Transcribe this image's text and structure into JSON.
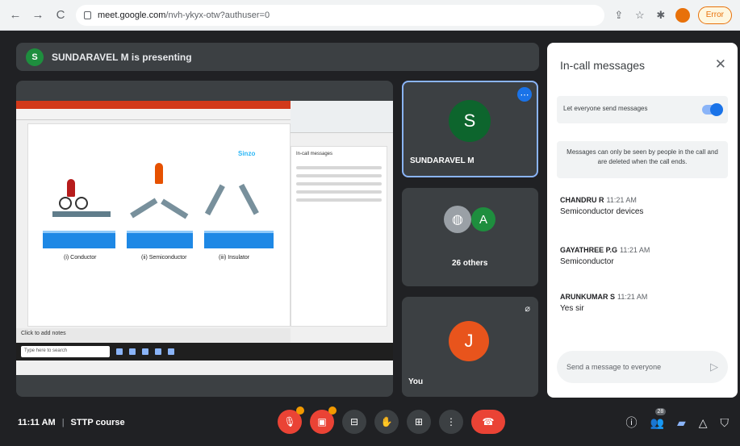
{
  "browser": {
    "url_host": "meet.google.com",
    "url_path": "/nvh-ykyx-otw?authuser=0",
    "profile_button": "Error",
    "nav": {
      "back": "←",
      "forward": "→",
      "reload": "C"
    }
  },
  "meet": {
    "presenting_initial": "S",
    "presenting_text": "SUNDARAVEL M is presenting",
    "shared_screen": {
      "status_bar": "Click to add notes",
      "taskbar_search": "Type here to search",
      "inner_chat_title": "In-call messages",
      "figure_captions": [
        "(i) Conductor",
        "(ii) Semiconductor",
        "(iii) Insulator"
      ],
      "logo_text": "Sinzo"
    },
    "tiles": [
      {
        "initial": "S",
        "name": "SUNDARAVEL M",
        "avatar_color": "#0d652d"
      },
      {
        "initial": "A",
        "name": "26 others",
        "avatar_color": "#1e8e3e"
      },
      {
        "initial": "J",
        "name": "You",
        "avatar_color": "#e8541c"
      }
    ],
    "chat": {
      "title": "In-call messages",
      "toggle_label": "Let everyone send messages",
      "toggle_on": true,
      "notice": "Messages can only be seen by people in the call and are deleted when the call ends.",
      "messages": [
        {
          "sender": "CHANDRU R",
          "time": "11:21 AM",
          "text": "Semiconductor devices"
        },
        {
          "sender": "GAYATHREE P.G",
          "time": "11:21 AM",
          "text": "Semiconductor"
        },
        {
          "sender": "ARUNKUMAR S",
          "time": "11:21 AM",
          "text": "Yes sir"
        }
      ],
      "input_placeholder": "Send a message to everyone"
    },
    "bottom_bar": {
      "time": "11:11 AM",
      "meeting_name": "STTP course",
      "separator": "|",
      "participant_count": "28"
    }
  },
  "colors": {
    "background": "#202124",
    "tile": "#3c4043",
    "accent": "#1a73e8",
    "danger": "#ea4335"
  }
}
